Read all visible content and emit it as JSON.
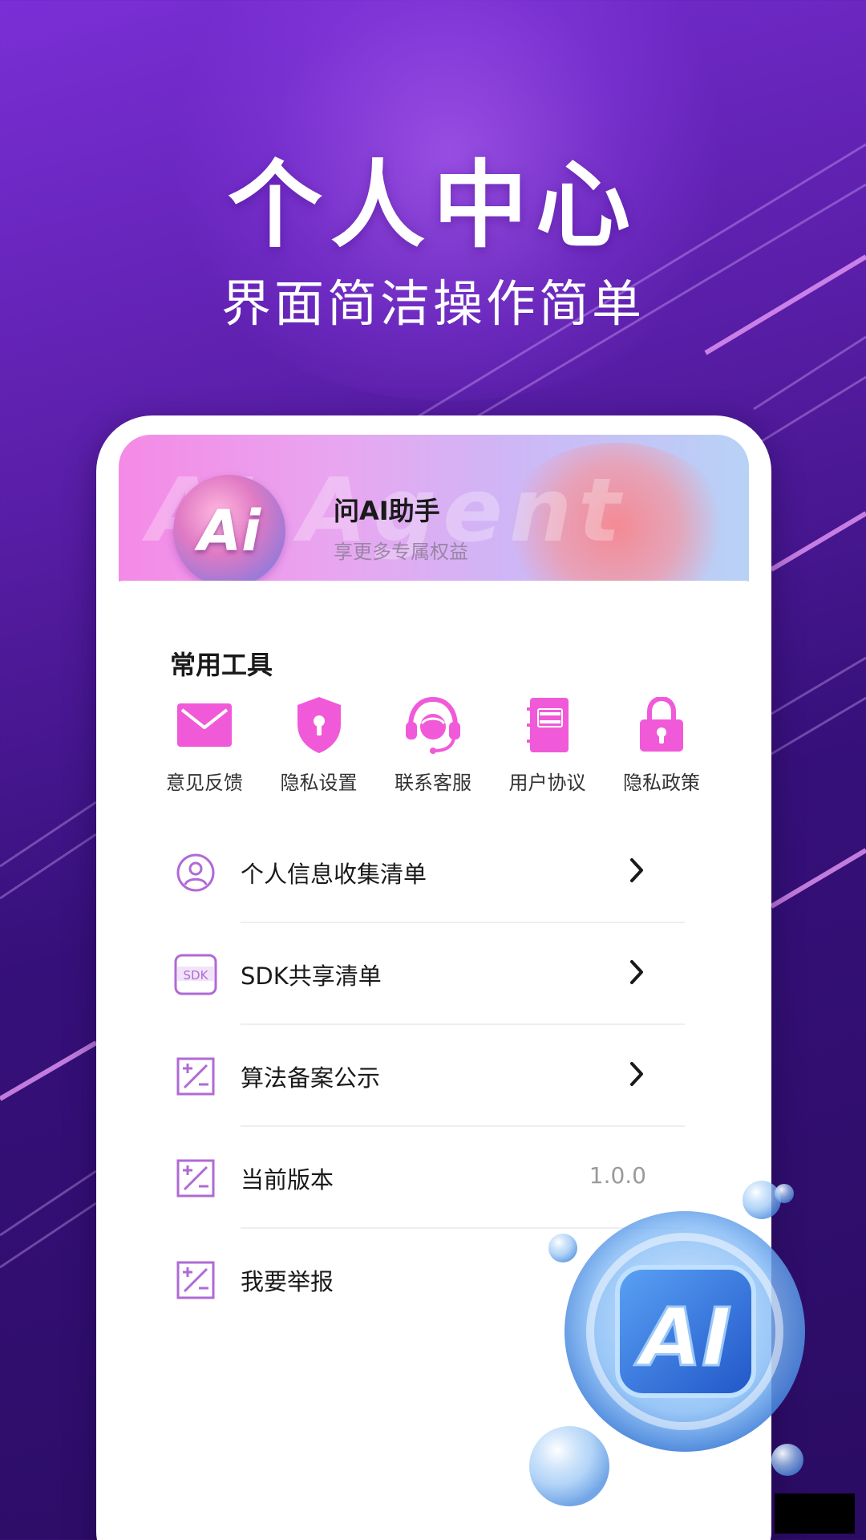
{
  "promo": {
    "title": "个人中心",
    "subtitle": "界面简洁操作简单"
  },
  "profile": {
    "avatar_text": "Ai",
    "watermark": "AI Agent",
    "app_name": "问AI助手",
    "tagline": "享更多专属权益"
  },
  "tools": {
    "section_title": "常用工具",
    "items": [
      {
        "label": "意见反馈",
        "icon": "mail-icon"
      },
      {
        "label": "隐私设置",
        "icon": "shield-icon"
      },
      {
        "label": "联系客服",
        "icon": "headset-icon"
      },
      {
        "label": "用户协议",
        "icon": "document-icon"
      },
      {
        "label": "隐私政策",
        "icon": "lock-icon"
      }
    ]
  },
  "menu": {
    "items": [
      {
        "label": "个人信息收集清单",
        "icon": "user-circle-icon",
        "trailing": "chevron"
      },
      {
        "label": "SDK共享清单",
        "icon": "sdk-icon",
        "icon_text": "SDK",
        "trailing": "chevron"
      },
      {
        "label": "算法备案公示",
        "icon": "plus-minus-icon",
        "trailing": "chevron"
      },
      {
        "label": "当前版本",
        "icon": "plus-minus-icon",
        "value": "1.0.0"
      },
      {
        "label": "我要举报",
        "icon": "plus-minus-icon"
      }
    ]
  },
  "decoration": {
    "badge_text": "AI"
  },
  "colors": {
    "accent_pink": "#f05ad8",
    "icon_purple": "#b06ad6",
    "background_purple": "#5a1ea8"
  }
}
